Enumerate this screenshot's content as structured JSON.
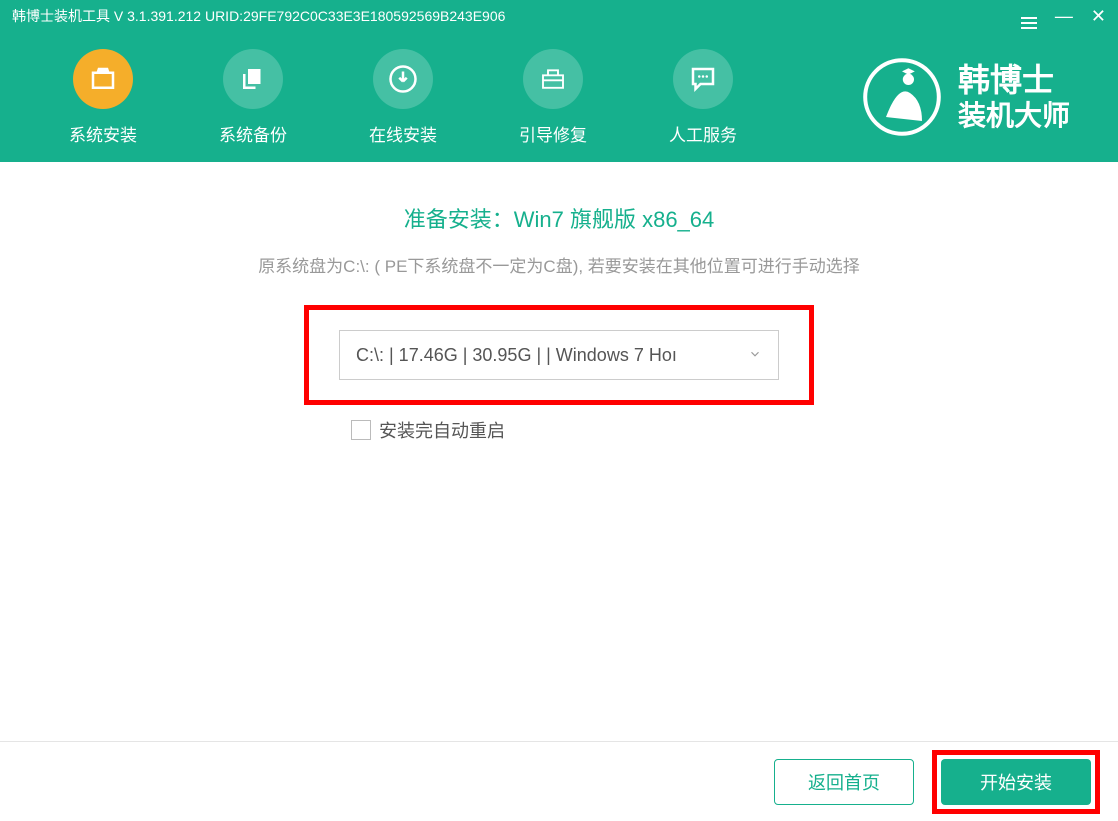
{
  "window": {
    "title": "韩博士装机工具 V 3.1.391.212 URID:29FE792C0C33E3E180592569B243E906"
  },
  "brand": {
    "line1": "韩博士",
    "line2": "装机大师"
  },
  "nav": {
    "items": [
      {
        "label": "系统安装",
        "icon": "box-icon",
        "active": true
      },
      {
        "label": "系统备份",
        "icon": "copy-icon",
        "active": false
      },
      {
        "label": "在线安装",
        "icon": "download-icon",
        "active": false
      },
      {
        "label": "引导修复",
        "icon": "toolbox-icon",
        "active": false
      },
      {
        "label": "人工服务",
        "icon": "chat-icon",
        "active": false
      }
    ]
  },
  "main": {
    "prepare_label": "准备安装：",
    "prepare_target": "Win7 旗舰版 x86_64",
    "hint": "原系统盘为C:\\: ( PE下系统盘不一定为C盘), 若要安装在其他位置可进行手动选择",
    "drive_select_value": "C:\\: | 17.46G | 30.95G |  | Windows 7 Hoı",
    "checkbox_label": "安装完自动重启"
  },
  "footer": {
    "back_label": "返回首页",
    "start_label": "开始安装"
  },
  "colors": {
    "primary": "#16B08D",
    "highlight": "#FF0000",
    "nav_active": "#F5AE2A",
    "nav_inactive": "#45C0A4"
  }
}
